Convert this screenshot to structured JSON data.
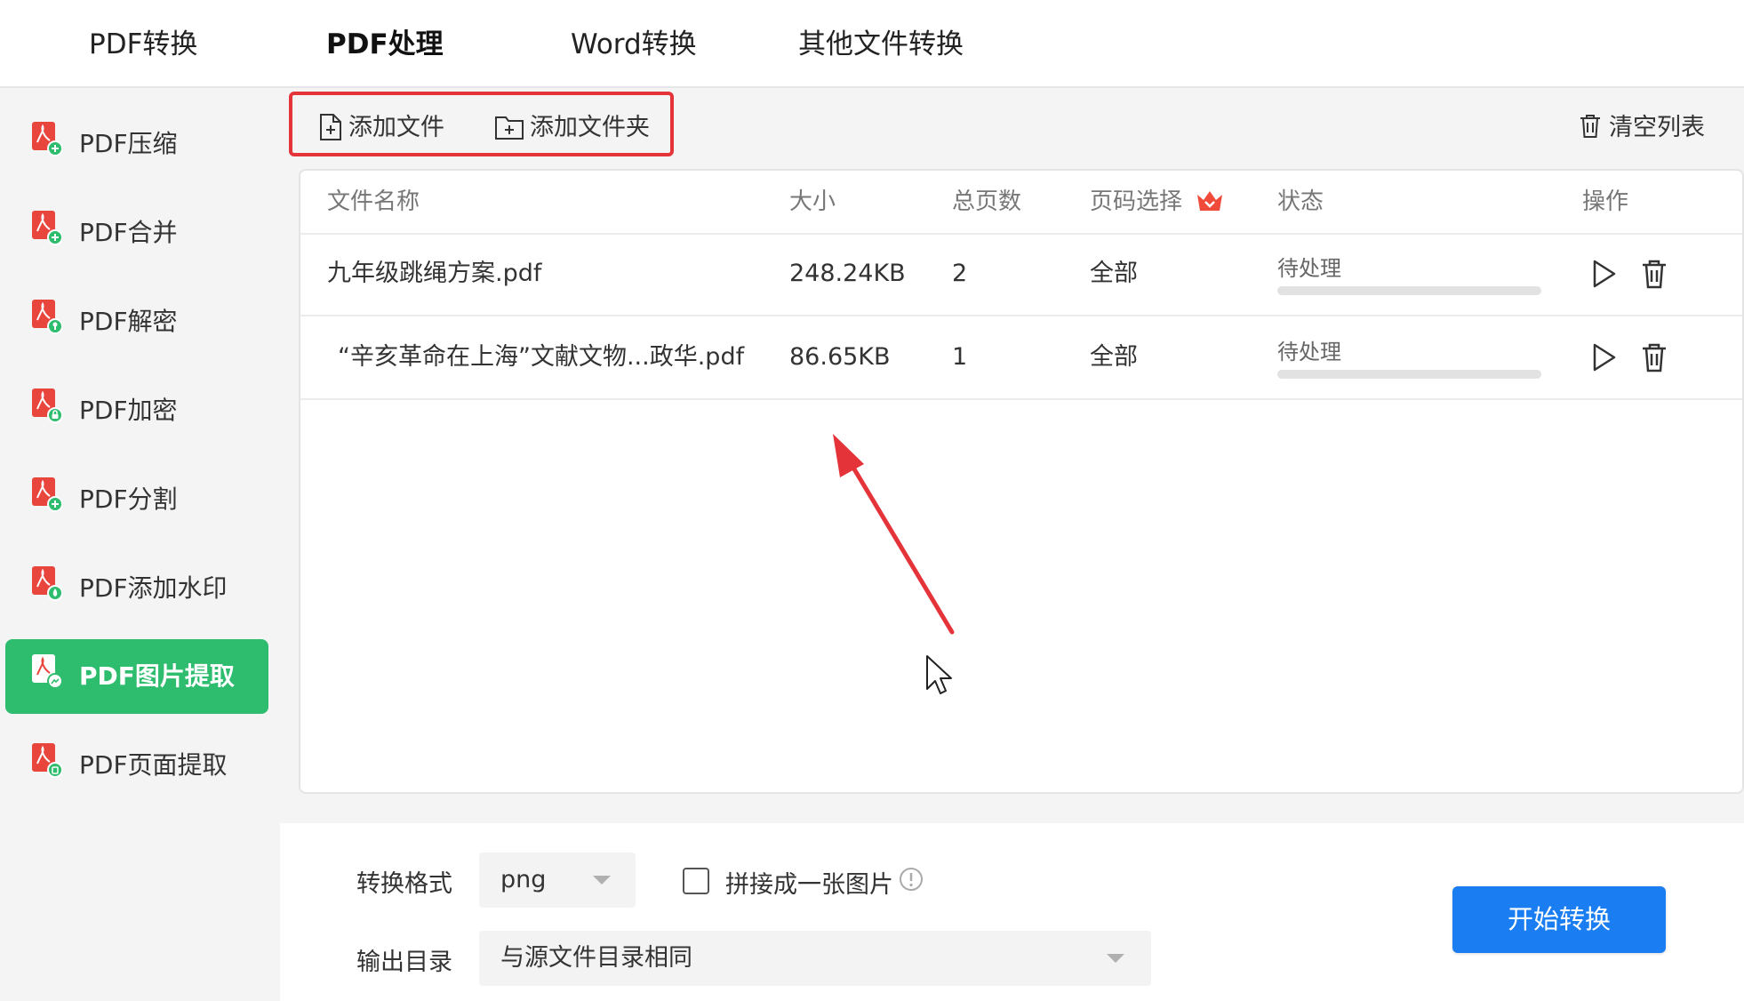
{
  "top_nav": {
    "tabs": [
      {
        "label": "PDF转换"
      },
      {
        "label": "PDF处理"
      },
      {
        "label": "Word转换"
      },
      {
        "label": "其他文件转换"
      }
    ]
  },
  "sidebar": {
    "items": [
      {
        "label": "PDF压缩",
        "icon": "pdf-compress-icon"
      },
      {
        "label": "PDF合并",
        "icon": "pdf-merge-icon"
      },
      {
        "label": "PDF解密",
        "icon": "pdf-decrypt-icon"
      },
      {
        "label": "PDF加密",
        "icon": "pdf-encrypt-icon"
      },
      {
        "label": "PDF分割",
        "icon": "pdf-split-icon"
      },
      {
        "label": "PDF添加水印",
        "icon": "pdf-watermark-icon"
      },
      {
        "label": "PDF图片提取",
        "icon": "pdf-image-extract-icon"
      },
      {
        "label": "PDF页面提取",
        "icon": "pdf-page-extract-icon"
      }
    ]
  },
  "toolbar": {
    "add_file": "添加文件",
    "add_folder": "添加文件夹",
    "clear_list": "清空列表"
  },
  "table": {
    "headers": {
      "name": "文件名称",
      "size": "大小",
      "pages": "总页数",
      "page_select": "页码选择",
      "status": "状态",
      "actions": "操作"
    },
    "rows": [
      {
        "name": "九年级跳绳方案.pdf",
        "size": "248.24KB",
        "pages": "2",
        "page_select": "全部",
        "status": "待处理",
        "progress": 0
      },
      {
        "name": "“辛亥革命在上海”文献文物...政华.pdf",
        "size": "86.65KB",
        "pages": "1",
        "page_select": "全部",
        "status": "待处理",
        "progress": 0
      }
    ]
  },
  "bottom": {
    "format_label": "转换格式",
    "format_value": "png",
    "merge_label": "拼接成一张图片",
    "merge_checked": false,
    "output_label": "输出目录",
    "output_value": "与源文件目录相同",
    "start_button": "开始转换"
  },
  "colors": {
    "accent_green": "#2ebd6e",
    "primary_blue": "#1a7ef2",
    "highlight_red": "#e5333a",
    "pdf_red": "#e8453c",
    "vip_badge": "#f04b3a"
  }
}
